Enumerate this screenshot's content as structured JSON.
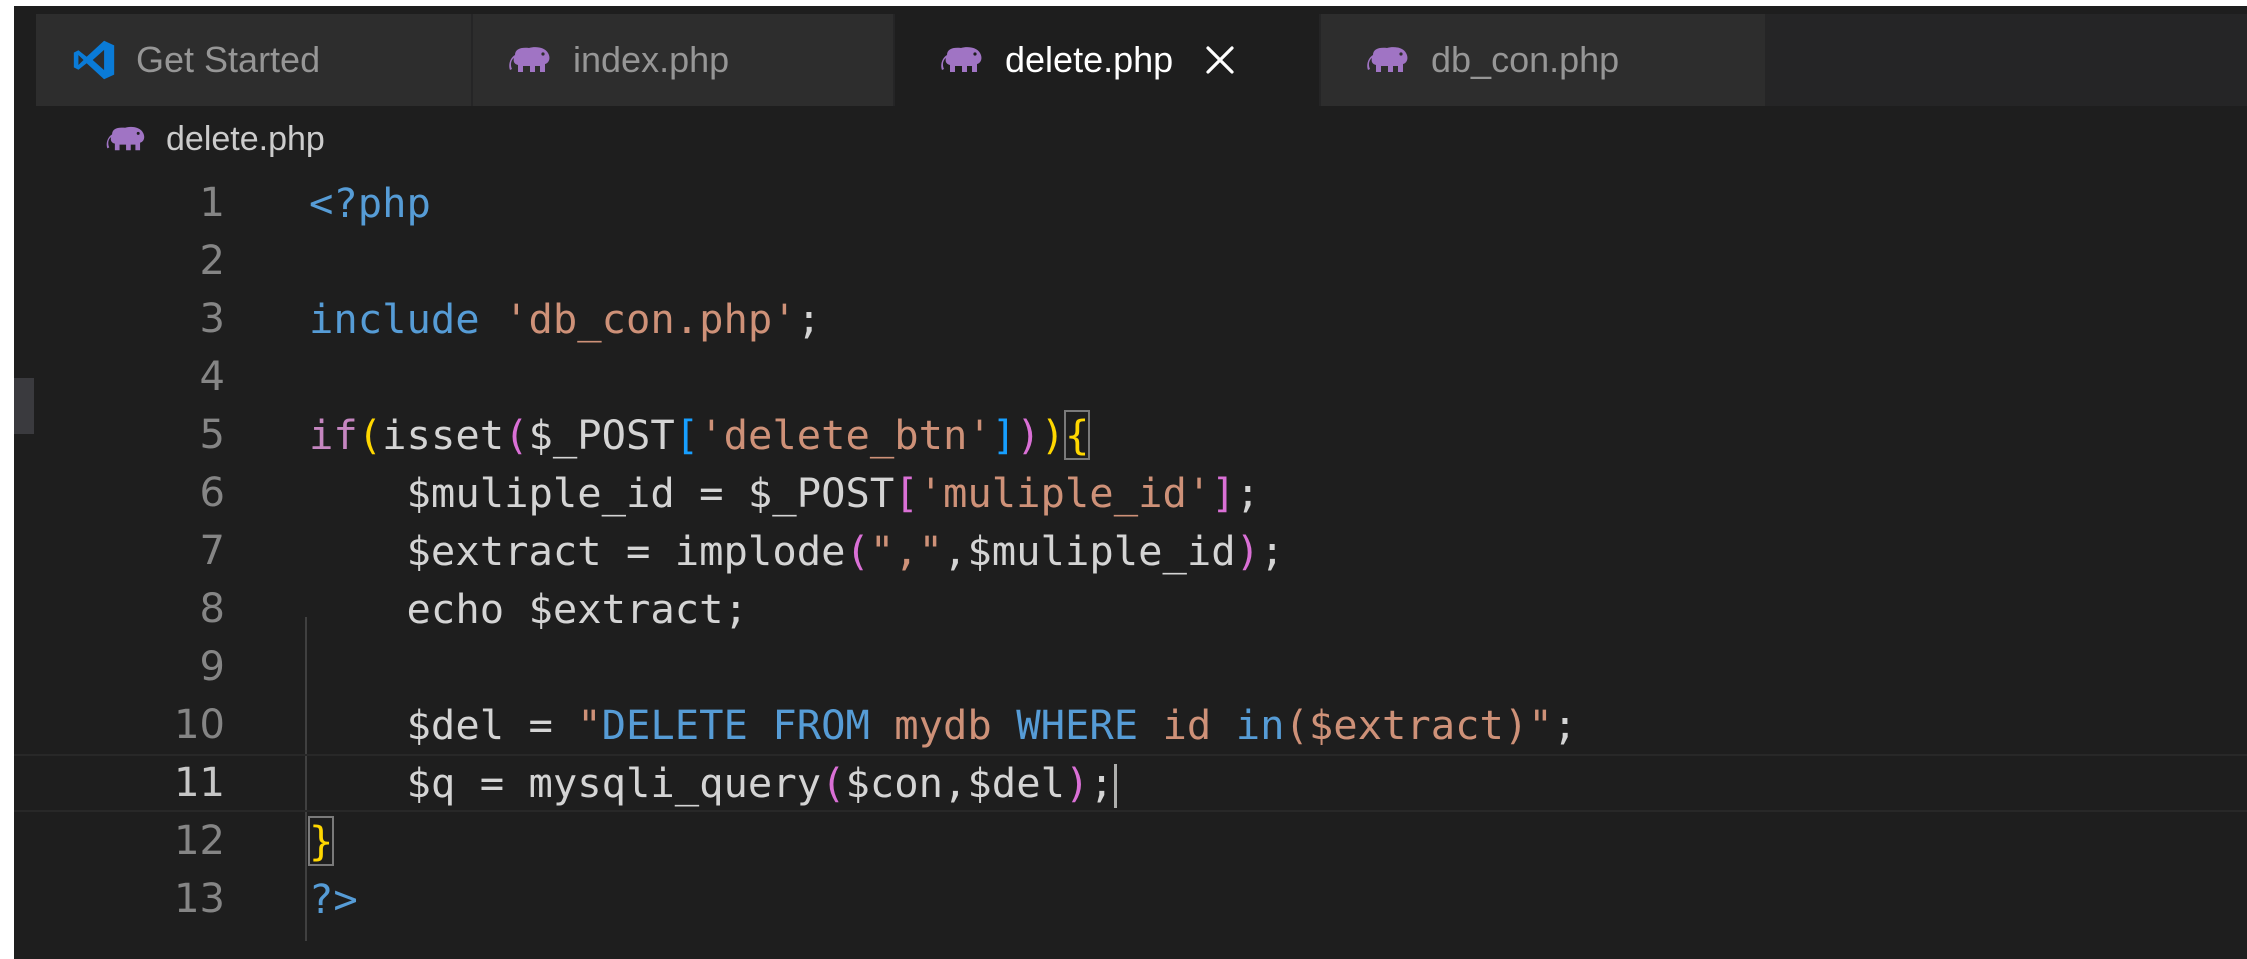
{
  "tabs": [
    {
      "label": "Get Started",
      "icon": "vscode-logo-icon",
      "active": false
    },
    {
      "label": "index.php",
      "icon": "php-elephant-icon",
      "active": false
    },
    {
      "label": "delete.php",
      "icon": "php-elephant-icon",
      "active": true,
      "close": "×"
    },
    {
      "label": "db_con.php",
      "icon": "php-elephant-icon",
      "active": false
    }
  ],
  "breadcrumb": {
    "file": "delete.php",
    "icon": "php-elephant-icon"
  },
  "editor": {
    "active_line": 11,
    "lines": [
      {
        "n": "1",
        "tokens": [
          [
            "tag",
            "<?php"
          ]
        ]
      },
      {
        "n": "2",
        "tokens": []
      },
      {
        "n": "3",
        "tokens": [
          [
            "kw",
            "include"
          ],
          [
            "plain",
            " "
          ],
          [
            "str",
            "'db_con.php'"
          ],
          [
            "plain",
            ";"
          ]
        ]
      },
      {
        "n": "4",
        "tokens": []
      },
      {
        "n": "5",
        "tokens": [
          [
            "ctl",
            "if"
          ],
          [
            "b1",
            "("
          ],
          [
            "plain",
            "isset"
          ],
          [
            "b2",
            "("
          ],
          [
            "var",
            "$_POST"
          ],
          [
            "b3",
            "["
          ],
          [
            "str",
            "'delete_btn'"
          ],
          [
            "b3",
            "]"
          ],
          [
            "b2",
            ")"
          ],
          [
            "b1",
            ")"
          ],
          [
            "b1bm",
            "{"
          ]
        ]
      },
      {
        "n": "6",
        "tokens": [
          [
            "plain",
            "    "
          ],
          [
            "var",
            "$muliple_id"
          ],
          [
            "plain",
            " = "
          ],
          [
            "var",
            "$_POST"
          ],
          [
            "b2",
            "["
          ],
          [
            "str",
            "'muliple_id'"
          ],
          [
            "b2",
            "]"
          ],
          [
            "plain",
            ";"
          ]
        ]
      },
      {
        "n": "7",
        "tokens": [
          [
            "plain",
            "    "
          ],
          [
            "var",
            "$extract"
          ],
          [
            "plain",
            " = "
          ],
          [
            "plain",
            "implode"
          ],
          [
            "b2",
            "("
          ],
          [
            "str",
            "\",\""
          ],
          [
            "plain",
            ","
          ],
          [
            "var",
            "$muliple_id"
          ],
          [
            "b2",
            ")"
          ],
          [
            "plain",
            ";"
          ]
        ]
      },
      {
        "n": "8",
        "tokens": [
          [
            "plain",
            "    "
          ],
          [
            "plain",
            "echo"
          ],
          [
            "plain",
            " "
          ],
          [
            "var",
            "$extract"
          ],
          [
            "plain",
            ";"
          ]
        ]
      },
      {
        "n": "9",
        "tokens": []
      },
      {
        "n": "10",
        "tokens": [
          [
            "plain",
            "    "
          ],
          [
            "var",
            "$del"
          ],
          [
            "plain",
            " = "
          ],
          [
            "str",
            "\""
          ],
          [
            "kw",
            "DELETE"
          ],
          [
            "plain",
            " "
          ],
          [
            "kw",
            "FROM"
          ],
          [
            "plain",
            " "
          ],
          [
            "str",
            "mydb"
          ],
          [
            "plain",
            " "
          ],
          [
            "kw",
            "WHERE"
          ],
          [
            "plain",
            " "
          ],
          [
            "str",
            "id"
          ],
          [
            "plain",
            " "
          ],
          [
            "kw",
            "in"
          ],
          [
            "str",
            "($extract)\""
          ],
          [
            "plain",
            ";"
          ]
        ]
      },
      {
        "n": "11",
        "tokens": [
          [
            "plain",
            "    "
          ],
          [
            "var",
            "$q"
          ],
          [
            "plain",
            " = "
          ],
          [
            "plain",
            "mysqli_query"
          ],
          [
            "b2",
            "("
          ],
          [
            "var",
            "$con"
          ],
          [
            "plain",
            ","
          ],
          [
            "var",
            "$del"
          ],
          [
            "b2",
            ")"
          ],
          [
            "plain",
            ";"
          ],
          [
            "cursor",
            ""
          ]
        ]
      },
      {
        "n": "12",
        "tokens": [
          [
            "b1bm",
            "}"
          ]
        ]
      },
      {
        "n": "13",
        "tokens": [
          [
            "tag",
            "?>"
          ]
        ]
      }
    ]
  },
  "colors": {
    "editor_bg": "#1e1e1e",
    "tab_inactive_bg": "#2d2d2d",
    "keyword": "#569cd6",
    "control": "#c586c0",
    "string": "#ce9178",
    "php_icon": "#a074c4",
    "vscode_blue": "#0a7bd7"
  }
}
